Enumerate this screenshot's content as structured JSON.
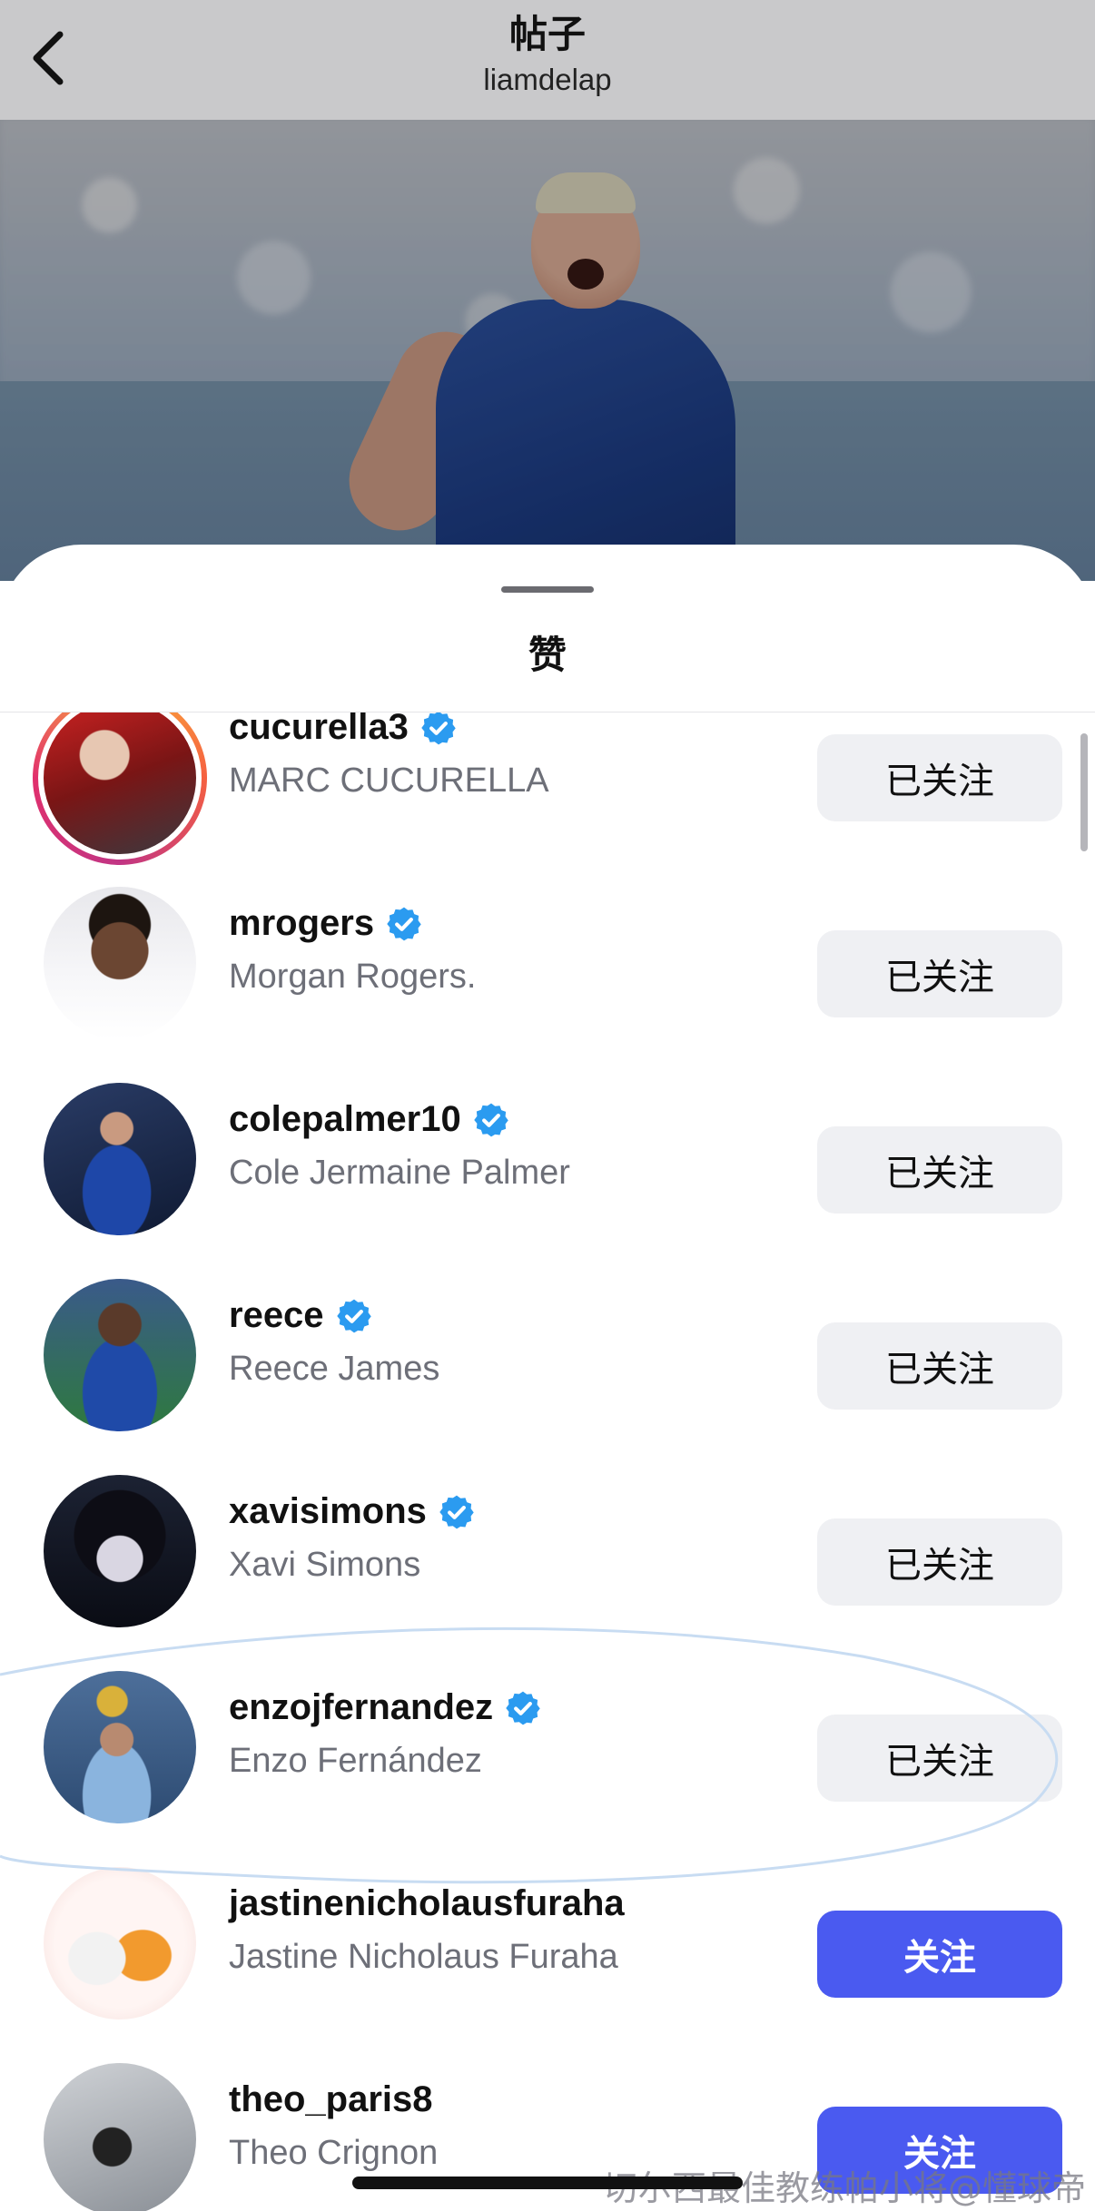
{
  "header": {
    "title": "帖子",
    "subtitle": "liamdelap"
  },
  "sheet": {
    "title": "赞"
  },
  "likers": [
    {
      "username": "cucurella3",
      "full_name": "MARC CUCURELLA",
      "verified": true,
      "button": "已关注",
      "state": "following",
      "story_ring": true
    },
    {
      "username": "mrogers",
      "full_name": "Morgan Rogers.",
      "verified": true,
      "button": "已关注",
      "state": "following"
    },
    {
      "username": "colepalmer10",
      "full_name": "Cole Jermaine Palmer",
      "verified": true,
      "button": "已关注",
      "state": "following"
    },
    {
      "username": "reece",
      "full_name": "Reece James",
      "verified": true,
      "button": "已关注",
      "state": "following"
    },
    {
      "username": "xavisimons",
      "full_name": "Xavi Simons",
      "verified": true,
      "button": "已关注",
      "state": "following"
    },
    {
      "username": "enzojfernandez",
      "full_name": "Enzo Fernández",
      "verified": true,
      "button": "已关注",
      "state": "following"
    },
    {
      "username": "jastinenicholausfuraha",
      "full_name": "Jastine Nicholaus Furaha",
      "verified": false,
      "button": "关注",
      "state": "follow"
    },
    {
      "username": "theo_paris8",
      "full_name": "Theo Crignon",
      "verified": false,
      "button": "关注",
      "state": "follow"
    }
  ],
  "watermark": "切尔西最佳教练帕小将@懂球帝",
  "colors": {
    "follow_button": "#4a5af0",
    "following_button": "#eff0f3",
    "verified_badge": "#2b9bf0"
  }
}
